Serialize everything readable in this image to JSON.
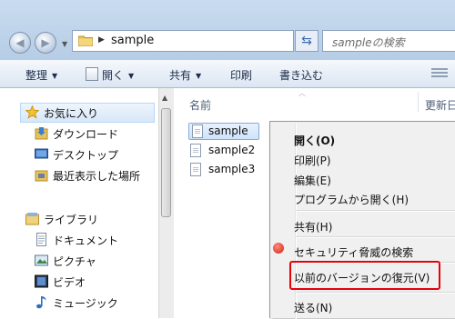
{
  "address": {
    "path": "sample"
  },
  "search": {
    "placeholder": "sampleの検索"
  },
  "toolbar": {
    "organize": "整理",
    "open": "開く",
    "share": "共有",
    "print": "印刷",
    "burn": "書き込む"
  },
  "sidebar": {
    "favorites": "お気に入り",
    "downloads": "ダウンロード",
    "desktop": "デスクトップ",
    "recent": "最近表示した場所",
    "libraries": "ライブラリ",
    "documents": "ドキュメント",
    "pictures": "ピクチャ",
    "videos": "ビデオ",
    "music": "ミュージック"
  },
  "columns": {
    "name": "名前",
    "date": "更新日"
  },
  "files": [
    "sample",
    "sample2",
    "sample3"
  ],
  "context_menu": {
    "open": "開く(O)",
    "print": "印刷(P)",
    "edit": "編集(E)",
    "open_with": "プログラムから開く(H)",
    "share": "共有(H)",
    "security_search": "セキュリティ脅威の検索",
    "restore_previous": "以前のバージョンの復元(V)",
    "send_to": "送る(N)"
  },
  "colors": {
    "highlight": "#e8000b",
    "selection": "#cfe3fb"
  }
}
